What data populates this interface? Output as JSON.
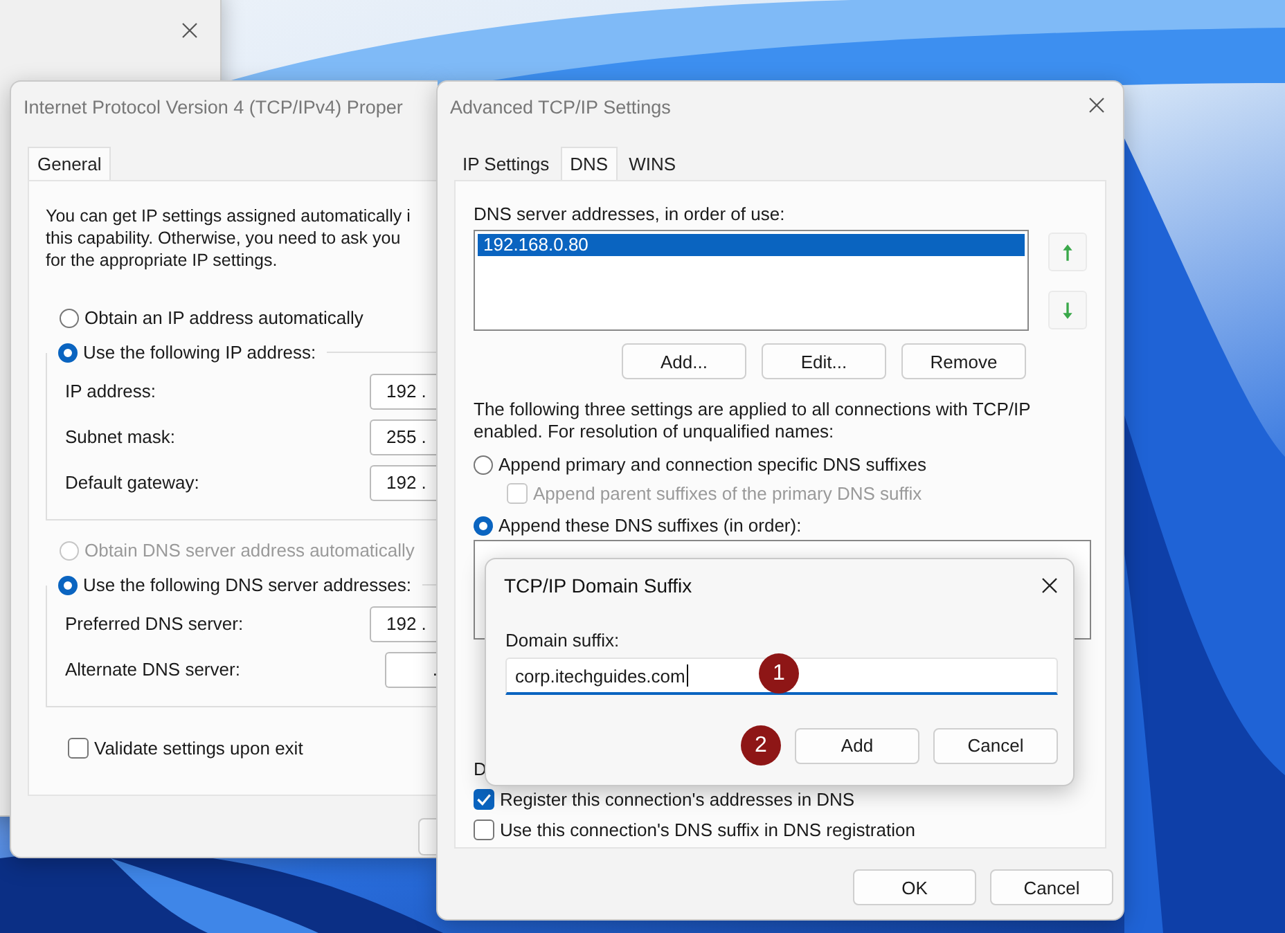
{
  "ipv4_window": {
    "title": "Internet Protocol Version 4 (TCP/IPv4) Proper",
    "tabs": [
      {
        "label": "General",
        "selected": true
      }
    ],
    "intro": [
      "You can get IP settings assigned automatically i",
      "this capability. Otherwise, you need to ask you",
      "for the appropriate IP settings."
    ],
    "ip_mode": [
      {
        "label": "Obtain an IP address automatically",
        "selected": false,
        "disabled": false
      },
      {
        "label": "Use the following IP address:",
        "selected": true,
        "disabled": false
      }
    ],
    "ip_fields": [
      {
        "label": "IP address:",
        "value": "192 ."
      },
      {
        "label": "Subnet mask:",
        "value": "255 ."
      },
      {
        "label": "Default gateway:",
        "value": "192 ."
      }
    ],
    "dns_mode": [
      {
        "label": "Obtain DNS server address automatically",
        "selected": false,
        "disabled": true
      },
      {
        "label": "Use the following DNS server addresses:",
        "selected": true,
        "disabled": false
      }
    ],
    "dns_fields": [
      {
        "label": "Preferred DNS server:",
        "value": "192 ."
      },
      {
        "label": "Alternate DNS server:",
        "value": "."
      }
    ],
    "validate": {
      "label": "Validate settings upon exit",
      "checked": false
    }
  },
  "advanced_window": {
    "title": "Advanced TCP/IP Settings",
    "tabs": [
      {
        "label": "IP Settings",
        "selected": false
      },
      {
        "label": "DNS",
        "selected": true
      },
      {
        "label": "WINS",
        "selected": false
      }
    ],
    "server_list_label": "DNS server addresses, in order of use:",
    "servers": [
      {
        "address": "192.168.0.80",
        "selected": true
      }
    ],
    "list_buttons": [
      "Add...",
      "Edit...",
      "Remove"
    ],
    "note": "The following three settings are applied to all connections with TCP/IP enabled. For resolution of unqualified names:",
    "resolution_options": [
      {
        "kind": "radio",
        "label": "Append primary and connection specific DNS suffixes",
        "selected": false,
        "disabled": false
      },
      {
        "kind": "checkbox",
        "label": "Append parent suffixes of the primary DNS suffix",
        "checked": false,
        "disabled": true
      },
      {
        "kind": "radio",
        "label": "Append these DNS suffixes (in order):",
        "selected": true,
        "disabled": false
      }
    ],
    "suffix_label": "D",
    "registration": [
      {
        "label": "Register this connection's addresses in DNS",
        "checked": true
      },
      {
        "label": "Use this connection's DNS suffix in DNS registration",
        "checked": false
      }
    ],
    "buttons": [
      "OK",
      "Cancel"
    ]
  },
  "suffix_dialog": {
    "title": "TCP/IP Domain Suffix",
    "field_label": "Domain suffix:",
    "value": "corp.itechguides.com",
    "buttons": [
      "Add",
      "Cancel"
    ]
  },
  "annotations": [
    {
      "number": "1"
    },
    {
      "number": "2"
    }
  ]
}
